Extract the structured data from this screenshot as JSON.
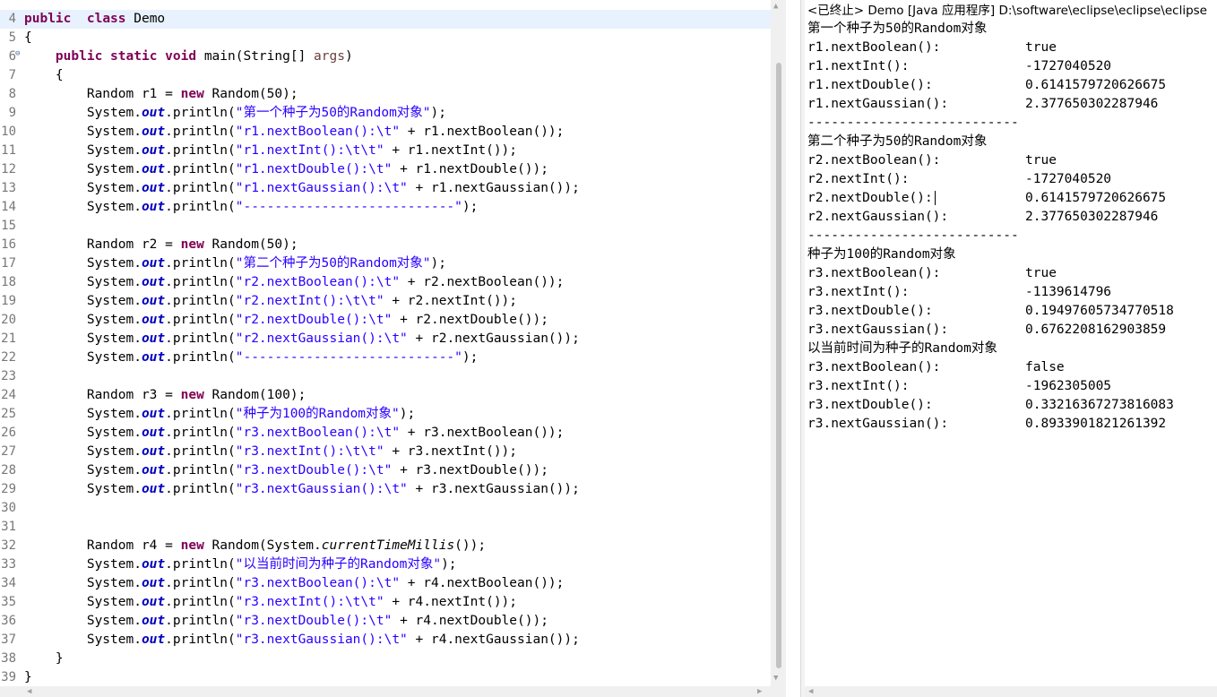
{
  "editor": {
    "lines": [
      {
        "num": "4",
        "fold": "",
        "current": true,
        "tokens": [
          [
            "kw",
            "public"
          ],
          [
            "",
            "  "
          ],
          [
            "kw",
            "class"
          ],
          [
            "",
            " Demo"
          ]
        ]
      },
      {
        "num": "5",
        "tokens": [
          [
            "",
            "{"
          ]
        ]
      },
      {
        "num": "6",
        "fold": "⊖",
        "tokens": [
          [
            "",
            "    "
          ],
          [
            "kw",
            "public"
          ],
          [
            "",
            " "
          ],
          [
            "kw",
            "static"
          ],
          [
            "",
            " "
          ],
          [
            "kw",
            "void"
          ],
          [
            "",
            " main(String[] "
          ],
          [
            "prm",
            "args"
          ],
          [
            "",
            ")"
          ]
        ]
      },
      {
        "num": "7",
        "tokens": [
          [
            "",
            "    {"
          ]
        ]
      },
      {
        "num": "8",
        "tokens": [
          [
            "",
            "        Random r1 = "
          ],
          [
            "kw",
            "new"
          ],
          [
            "",
            " Random(50);"
          ]
        ]
      },
      {
        "num": "9",
        "tokens": [
          [
            "",
            "        System."
          ],
          [
            "fld",
            "out"
          ],
          [
            "",
            ".println("
          ],
          [
            "str",
            "\"第一个种子为50的Random对象\""
          ],
          [
            "",
            ");"
          ]
        ]
      },
      {
        "num": "10",
        "tokens": [
          [
            "",
            "        System."
          ],
          [
            "fld",
            "out"
          ],
          [
            "",
            ".println("
          ],
          [
            "str",
            "\"r1.nextBoolean():\\t\""
          ],
          [
            "",
            " + r1.nextBoolean());"
          ]
        ]
      },
      {
        "num": "11",
        "tokens": [
          [
            "",
            "        System."
          ],
          [
            "fld",
            "out"
          ],
          [
            "",
            ".println("
          ],
          [
            "str",
            "\"r1.nextInt():\\t\\t\""
          ],
          [
            "",
            " + r1.nextInt());"
          ]
        ]
      },
      {
        "num": "12",
        "tokens": [
          [
            "",
            "        System."
          ],
          [
            "fld",
            "out"
          ],
          [
            "",
            ".println("
          ],
          [
            "str",
            "\"r1.nextDouble():\\t\""
          ],
          [
            "",
            " + r1.nextDouble());"
          ]
        ]
      },
      {
        "num": "13",
        "tokens": [
          [
            "",
            "        System."
          ],
          [
            "fld",
            "out"
          ],
          [
            "",
            ".println("
          ],
          [
            "str",
            "\"r1.nextGaussian():\\t\""
          ],
          [
            "",
            " + r1.nextGaussian());"
          ]
        ]
      },
      {
        "num": "14",
        "tokens": [
          [
            "",
            "        System."
          ],
          [
            "fld",
            "out"
          ],
          [
            "",
            ".println("
          ],
          [
            "str",
            "\"---------------------------\""
          ],
          [
            "",
            ");"
          ]
        ]
      },
      {
        "num": "15",
        "tokens": []
      },
      {
        "num": "16",
        "tokens": [
          [
            "",
            "        Random r2 = "
          ],
          [
            "kw",
            "new"
          ],
          [
            "",
            " Random(50);"
          ]
        ]
      },
      {
        "num": "17",
        "tokens": [
          [
            "",
            "        System."
          ],
          [
            "fld",
            "out"
          ],
          [
            "",
            ".println("
          ],
          [
            "str",
            "\"第二个种子为50的Random对象\""
          ],
          [
            "",
            ");"
          ]
        ]
      },
      {
        "num": "18",
        "tokens": [
          [
            "",
            "        System."
          ],
          [
            "fld",
            "out"
          ],
          [
            "",
            ".println("
          ],
          [
            "str",
            "\"r2.nextBoolean():\\t\""
          ],
          [
            "",
            " + r2.nextBoolean());"
          ]
        ]
      },
      {
        "num": "19",
        "tokens": [
          [
            "",
            "        System."
          ],
          [
            "fld",
            "out"
          ],
          [
            "",
            ".println("
          ],
          [
            "str",
            "\"r2.nextInt():\\t\\t\""
          ],
          [
            "",
            " + r2.nextInt());"
          ]
        ]
      },
      {
        "num": "20",
        "tokens": [
          [
            "",
            "        System."
          ],
          [
            "fld",
            "out"
          ],
          [
            "",
            ".println("
          ],
          [
            "str",
            "\"r2.nextDouble():\\t\""
          ],
          [
            "",
            " + r2.nextDouble());"
          ]
        ]
      },
      {
        "num": "21",
        "tokens": [
          [
            "",
            "        System."
          ],
          [
            "fld",
            "out"
          ],
          [
            "",
            ".println("
          ],
          [
            "str",
            "\"r2.nextGaussian():\\t\""
          ],
          [
            "",
            " + r2.nextGaussian());"
          ]
        ]
      },
      {
        "num": "22",
        "tokens": [
          [
            "",
            "        System."
          ],
          [
            "fld",
            "out"
          ],
          [
            "",
            ".println("
          ],
          [
            "str",
            "\"---------------------------\""
          ],
          [
            "",
            ");"
          ]
        ]
      },
      {
        "num": "23",
        "tokens": []
      },
      {
        "num": "24",
        "tokens": [
          [
            "",
            "        Random r3 = "
          ],
          [
            "kw",
            "new"
          ],
          [
            "",
            " Random(100);"
          ]
        ]
      },
      {
        "num": "25",
        "tokens": [
          [
            "",
            "        System."
          ],
          [
            "fld",
            "out"
          ],
          [
            "",
            ".println("
          ],
          [
            "str",
            "\"种子为100的Random对象\""
          ],
          [
            "",
            ");"
          ]
        ]
      },
      {
        "num": "26",
        "tokens": [
          [
            "",
            "        System."
          ],
          [
            "fld",
            "out"
          ],
          [
            "",
            ".println("
          ],
          [
            "str",
            "\"r3.nextBoolean():\\t\""
          ],
          [
            "",
            " + r3.nextBoolean());"
          ]
        ]
      },
      {
        "num": "27",
        "tokens": [
          [
            "",
            "        System."
          ],
          [
            "fld",
            "out"
          ],
          [
            "",
            ".println("
          ],
          [
            "str",
            "\"r3.nextInt():\\t\\t\""
          ],
          [
            "",
            " + r3.nextInt());"
          ]
        ]
      },
      {
        "num": "28",
        "tokens": [
          [
            "",
            "        System."
          ],
          [
            "fld",
            "out"
          ],
          [
            "",
            ".println("
          ],
          [
            "str",
            "\"r3.nextDouble():\\t\""
          ],
          [
            "",
            " + r3.nextDouble());"
          ]
        ]
      },
      {
        "num": "29",
        "tokens": [
          [
            "",
            "        System."
          ],
          [
            "fld",
            "out"
          ],
          [
            "",
            ".println("
          ],
          [
            "str",
            "\"r3.nextGaussian():\\t\""
          ],
          [
            "",
            " + r3.nextGaussian());"
          ]
        ]
      },
      {
        "num": "30",
        "tokens": []
      },
      {
        "num": "31",
        "tokens": []
      },
      {
        "num": "32",
        "tokens": [
          [
            "",
            "        Random r4 = "
          ],
          [
            "kw",
            "new"
          ],
          [
            "",
            " Random(System."
          ],
          [
            "sm",
            "currentTimeMillis"
          ],
          [
            "",
            "());"
          ]
        ]
      },
      {
        "num": "33",
        "tokens": [
          [
            "",
            "        System."
          ],
          [
            "fld",
            "out"
          ],
          [
            "",
            ".println("
          ],
          [
            "str",
            "\"以当前时间为种子的Random对象\""
          ],
          [
            "",
            ");"
          ]
        ]
      },
      {
        "num": "34",
        "tokens": [
          [
            "",
            "        System."
          ],
          [
            "fld",
            "out"
          ],
          [
            "",
            ".println("
          ],
          [
            "str",
            "\"r3.nextBoolean():\\t\""
          ],
          [
            "",
            " + r4.nextBoolean());"
          ]
        ]
      },
      {
        "num": "35",
        "tokens": [
          [
            "",
            "        System."
          ],
          [
            "fld",
            "out"
          ],
          [
            "",
            ".println("
          ],
          [
            "str",
            "\"r3.nextInt():\\t\\t\""
          ],
          [
            "",
            " + r4.nextInt());"
          ]
        ]
      },
      {
        "num": "36",
        "tokens": [
          [
            "",
            "        System."
          ],
          [
            "fld",
            "out"
          ],
          [
            "",
            ".println("
          ],
          [
            "str",
            "\"r3.nextDouble():\\t\""
          ],
          [
            "",
            " + r4.nextDouble());"
          ]
        ]
      },
      {
        "num": "37",
        "tokens": [
          [
            "",
            "        System."
          ],
          [
            "fld",
            "out"
          ],
          [
            "",
            ".println("
          ],
          [
            "str",
            "\"r3.nextGaussian():\\t\""
          ],
          [
            "",
            " + r4.nextGaussian());"
          ]
        ]
      },
      {
        "num": "38",
        "tokens": [
          [
            "",
            "    }"
          ]
        ]
      },
      {
        "num": "39",
        "tokens": [
          [
            "",
            "}"
          ]
        ]
      }
    ]
  },
  "console": {
    "title": "<已终止> Demo [Java 应用程序] D:\\software\\eclipse\\eclipse\\eclipse",
    "lines": [
      {
        "label": "第一个种子为50的Random对象",
        "value": ""
      },
      {
        "label": "r1.nextBoolean():",
        "value": "true"
      },
      {
        "label": "r1.nextInt():",
        "value": "-1727040520"
      },
      {
        "label": "r1.nextDouble():",
        "value": "0.6141579720626675"
      },
      {
        "label": "r1.nextGaussian():",
        "value": "2.377650302287946"
      },
      {
        "label": "---------------------------",
        "value": ""
      },
      {
        "label": "第二个种子为50的Random对象",
        "value": ""
      },
      {
        "label": "r2.nextBoolean():",
        "value": "true"
      },
      {
        "label": "r2.nextInt():",
        "value": "-1727040520"
      },
      {
        "label": "r2.nextDouble():",
        "value": "0.6141579720626675",
        "caret": true
      },
      {
        "label": "r2.nextGaussian():",
        "value": "2.377650302287946"
      },
      {
        "label": "---------------------------",
        "value": ""
      },
      {
        "label": "种子为100的Random对象",
        "value": ""
      },
      {
        "label": "r3.nextBoolean():",
        "value": "true"
      },
      {
        "label": "r3.nextInt():",
        "value": "-1139614796"
      },
      {
        "label": "r3.nextDouble():",
        "value": "0.19497605734770518"
      },
      {
        "label": "r3.nextGaussian():",
        "value": "0.6762208162903859"
      },
      {
        "label": "以当前时间为种子的Random对象",
        "value": ""
      },
      {
        "label": "r3.nextBoolean():",
        "value": "false"
      },
      {
        "label": "r3.nextInt():",
        "value": "-1962305005"
      },
      {
        "label": "r3.nextDouble():",
        "value": "0.33216367273816083"
      },
      {
        "label": "r3.nextGaussian():",
        "value": "0.8933901821261392"
      }
    ]
  },
  "icons": {
    "up": "▲",
    "down": "▼",
    "left": "◀",
    "right": "▶"
  },
  "colors": {
    "keyword": "#7f0055",
    "string": "#2a00ff",
    "field": "#0000c0",
    "current_line": "#e8f2fe"
  }
}
